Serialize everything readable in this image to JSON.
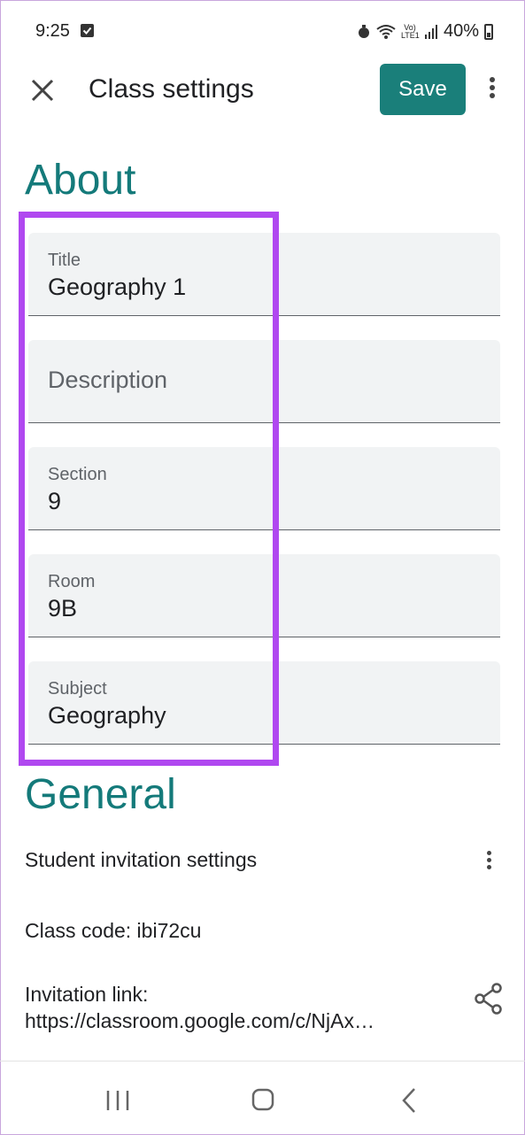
{
  "status_bar": {
    "time": "9:25",
    "network_label": "Vo) LTE1",
    "battery": "40%"
  },
  "app_bar": {
    "title": "Class settings",
    "save_label": "Save",
    "close_icon": "close-icon",
    "more_icon": "more-vert-icon"
  },
  "about": {
    "heading": "About",
    "fields": [
      {
        "label": "Title",
        "value": "Geography 1"
      },
      {
        "label": "",
        "placeholder": "Description",
        "value": ""
      },
      {
        "label": "Section",
        "value": "9"
      },
      {
        "label": "Room",
        "value": "9B"
      },
      {
        "label": "Subject",
        "value": "Geography"
      }
    ]
  },
  "general": {
    "heading": "General",
    "invitation_settings": "Student invitation settings",
    "class_code": "Class code: ibi72cu",
    "invitation_link_label": "Invitation link:",
    "invitation_link": "https://classroom.google.com/c/NjAx…"
  },
  "colors": {
    "accent": "#1a7f7a",
    "heading": "#147a7a",
    "highlight": "#b048f0",
    "field_bg": "#f1f3f4"
  }
}
